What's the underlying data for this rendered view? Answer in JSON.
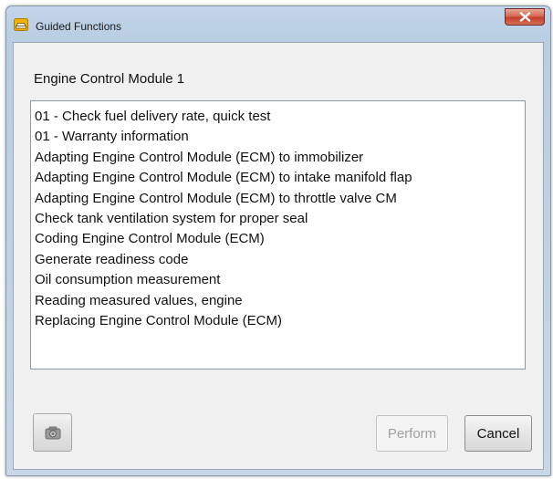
{
  "window": {
    "title": "Guided Functions",
    "icon": "car-icon"
  },
  "module_label": "Engine Control Module 1",
  "functions": [
    "01 - Check fuel delivery rate, quick test",
    "01 - Warranty information",
    "Adapting Engine Control Module (ECM) to immobilizer",
    "Adapting Engine Control Module (ECM) to intake manifold flap",
    "Adapting Engine Control Module (ECM) to throttle valve CM",
    "Check tank ventilation system for proper seal",
    "Coding Engine Control Module (ECM)",
    "Generate readiness code",
    "Oil consumption measurement",
    "Reading measured values, engine",
    "Replacing Engine Control Module (ECM)"
  ],
  "buttons": {
    "camera_icon": "camera-icon",
    "perform_label": "Perform",
    "cancel_label": "Cancel",
    "close_icon": "close-icon"
  }
}
